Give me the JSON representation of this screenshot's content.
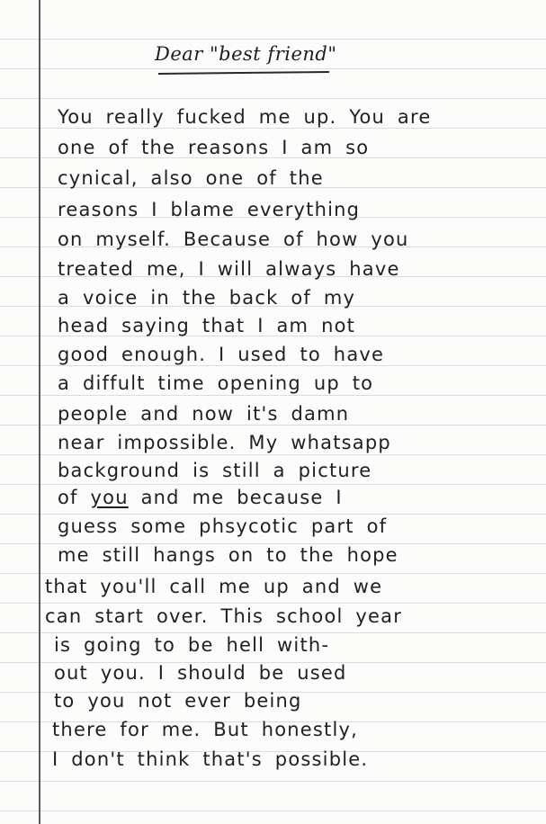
{
  "letter": {
    "title": "Dear \"best friend\"",
    "lines": [
      "You really fucked me up. You are",
      "one of the reasons I am so",
      "cynical, also one of the",
      "reasons I blame everything",
      "on myself. Because of how you",
      "treated me, I will always have",
      "a voice in the back of my",
      "head saying that I am not",
      "good enough. I used to have",
      "a diffult time opening up to",
      "people and now it's damn",
      "near impossible. My whatsapp",
      "background is still a picture",
      "of ",
      "you",
      " and me because I",
      "guess some phsycotic part of",
      "me still hangs on to the hope",
      "that you'll call me up and we",
      "can start over. This school year",
      "is going to be hell with-",
      "out you. I should be used",
      "to you not ever being",
      "there for me. But honestly,",
      "I don't think that's possible."
    ]
  }
}
